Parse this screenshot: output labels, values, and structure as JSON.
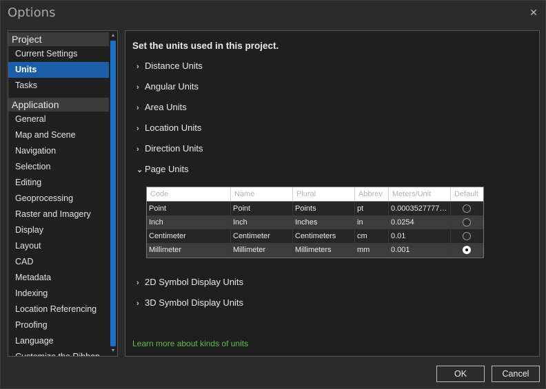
{
  "window": {
    "title": "Options",
    "close_glyph": "✕"
  },
  "sidebar": {
    "groups": [
      {
        "header": "Project",
        "items": [
          "Current Settings",
          "Units",
          "Tasks"
        ]
      },
      {
        "header": "Application",
        "items": [
          "General",
          "Map and Scene",
          "Navigation",
          "Selection",
          "Editing",
          "Geoprocessing",
          "Raster and Imagery",
          "Display",
          "Layout",
          "CAD",
          "Metadata",
          "Indexing",
          "Location Referencing",
          "Proofing",
          "Language",
          "Customize the Ribbon"
        ]
      }
    ],
    "selected": "Units",
    "scroll_up_glyph": "▲",
    "scroll_down_glyph": "▼"
  },
  "main": {
    "heading": "Set the units used in this project.",
    "sections": [
      {
        "label": "Distance Units",
        "expanded": false
      },
      {
        "label": "Angular Units",
        "expanded": false
      },
      {
        "label": "Area Units",
        "expanded": false
      },
      {
        "label": "Location Units",
        "expanded": false
      },
      {
        "label": "Direction Units",
        "expanded": false
      },
      {
        "label": "Page Units",
        "expanded": true
      },
      {
        "label": "2D Symbol Display Units",
        "expanded": false
      },
      {
        "label": "3D Symbol Display Units",
        "expanded": false
      }
    ],
    "chevron_collapsed": "›",
    "chevron_expanded": "⌄",
    "page_units_table": {
      "columns": [
        "Code",
        "Name",
        "Plural",
        "Abbrev",
        "Meters/Unit",
        "Default"
      ],
      "rows": [
        {
          "code": "Point",
          "name": "Point",
          "plural": "Points",
          "abbrev": "pt",
          "meters": "0.0003527777…",
          "default": false
        },
        {
          "code": "Inch",
          "name": "Inch",
          "plural": "Inches",
          "abbrev": "in",
          "meters": "0.0254",
          "default": false
        },
        {
          "code": "Centimeter",
          "name": "Centimeter",
          "plural": "Centimeters",
          "abbrev": "cm",
          "meters": "0.01",
          "default": false
        },
        {
          "code": "Millimeter",
          "name": "Millimeter",
          "plural": "Millimeters",
          "abbrev": "mm",
          "meters": "0.001",
          "default": true
        }
      ]
    },
    "learn_more": "Learn more about kinds of units"
  },
  "footer": {
    "ok_label": "OK",
    "cancel_label": "Cancel"
  },
  "colors": {
    "accent": "#1a5ea8",
    "scroll_thumb": "#1c6fc4",
    "link": "#5fbf4a"
  }
}
